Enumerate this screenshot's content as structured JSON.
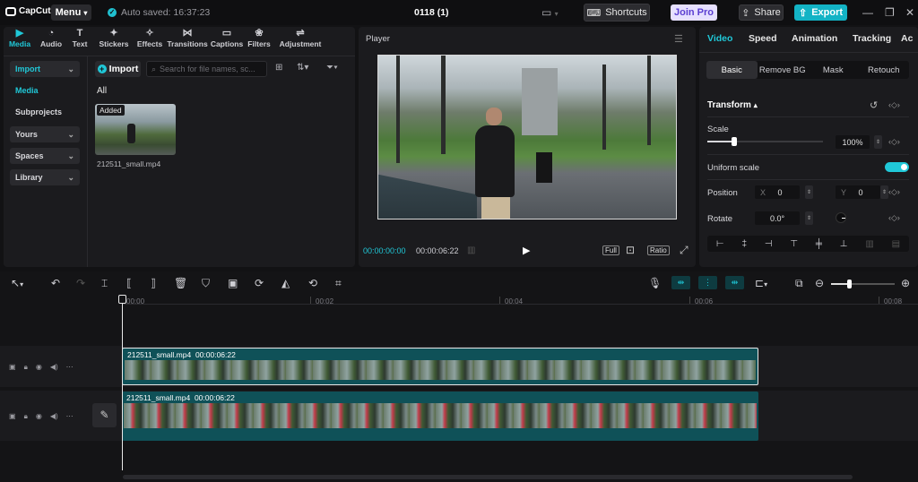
{
  "titlebar": {
    "app_name": "CapCut",
    "menu_label": "Menu",
    "autosave_text": "Auto saved: 16:37:23",
    "project_title": "0118 (1)",
    "shortcuts_label": "Shortcuts",
    "joinpro_label": "Join Pro",
    "share_label": "Share",
    "export_label": "Export"
  },
  "media_tabs": [
    {
      "label": "Media",
      "icon": "media-icon"
    },
    {
      "label": "Audio",
      "icon": "audio-icon"
    },
    {
      "label": "Text",
      "icon": "text-icon"
    },
    {
      "label": "Stickers",
      "icon": "stickers-icon"
    },
    {
      "label": "Effects",
      "icon": "effects-icon"
    },
    {
      "label": "Transitions",
      "icon": "transitions-icon"
    },
    {
      "label": "Captions",
      "icon": "captions-icon"
    },
    {
      "label": "Filters",
      "icon": "filters-icon"
    },
    {
      "label": "Adjustment",
      "icon": "adjustment-icon"
    }
  ],
  "sidebar": {
    "import": "Import",
    "media": "Media",
    "subprojects": "Subprojects",
    "yours": "Yours",
    "spaces": "Spaces",
    "library": "Library"
  },
  "media": {
    "import_label": "Import",
    "search_placeholder": "Search for file names, sc...",
    "filter_all": "All",
    "clip_badge": "Added",
    "clip_name": "212511_small.mp4"
  },
  "player": {
    "title": "Player",
    "current_time": "00:00:00:00",
    "total_time": "00:00:06:22",
    "full_label": "Full",
    "ratio_label": "Ratio"
  },
  "properties": {
    "tabs": [
      "Video",
      "Speed",
      "Animation",
      "Tracking",
      "Ac"
    ],
    "subtabs": [
      "Basic",
      "Remove BG",
      "Mask",
      "Retouch"
    ],
    "transform_label": "Transform",
    "scale_label": "Scale",
    "scale_value": "100%",
    "scale_fraction": 0.23,
    "uniform_scale_label": "Uniform scale",
    "uniform_scale_on": true,
    "position_label": "Position",
    "x_label": "X",
    "x_value": "0",
    "y_label": "Y",
    "y_value": "0",
    "rotate_label": "Rotate",
    "rotate_value": "0.0°"
  },
  "timeline": {
    "ruler": [
      "00:00",
      "00:02",
      "00:04",
      "00:06",
      "00:08"
    ],
    "track1": {
      "name": "212511_small.mp4",
      "duration": "00:00:06:22"
    },
    "track2": {
      "name": "212511_small.mp4",
      "duration": "00:00:06:22"
    },
    "zoom_fraction": 0.3
  },
  "colors": {
    "accent": "#20c8d8",
    "track": "#0f5158",
    "export": "#13b3c5"
  }
}
